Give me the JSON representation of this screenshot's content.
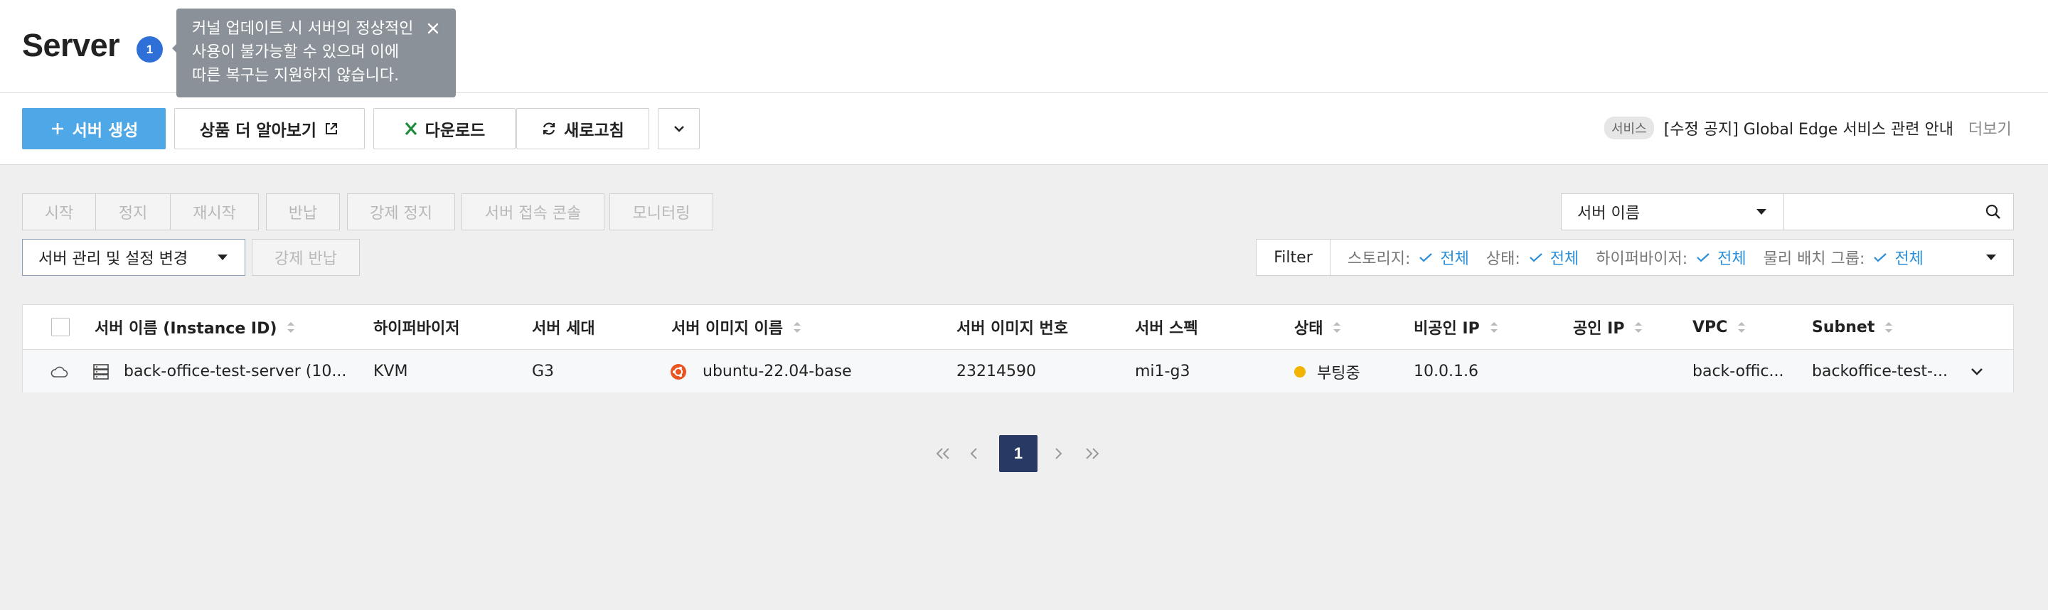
{
  "page": {
    "title": "Server",
    "badge_count": "1"
  },
  "tooltip": {
    "line1": "커널 업데이트 시 서버의 정상적인",
    "line2": "사용이 불가능할 수 있으며 이에",
    "line3": "따른 복구는 지원하지 않습니다."
  },
  "toolbar": {
    "create": "서버 생성",
    "learn_more": "상품 더 알아보기",
    "download": "다운로드",
    "refresh": "새로고침"
  },
  "notice": {
    "tag": "서비스",
    "text": "[수정 공지] Global Edge 서비스 관련 안내",
    "more": "더보기"
  },
  "actions": [
    "시작",
    "정지",
    "재시작",
    "반납",
    "강제 정지",
    "서버 접속 콘솔",
    "모니터링"
  ],
  "manage": {
    "label": "서버 관리 및 설정 변경",
    "force_return": "강제 반납"
  },
  "search": {
    "field": "서버 이름",
    "value": ""
  },
  "filter": {
    "label": "Filter",
    "items": [
      {
        "name": "스토리지:",
        "value": "전체"
      },
      {
        "name": "상태:",
        "value": "전체"
      },
      {
        "name": "하이퍼바이저:",
        "value": "전체"
      },
      {
        "name": "물리 배치 그룹:",
        "value": "전체"
      }
    ]
  },
  "table": {
    "columns": [
      "서버 이름 (Instance ID)",
      "하이퍼바이저",
      "서버 세대",
      "서버 이미지 이름",
      "서버 이미지 번호",
      "서버 스펙",
      "상태",
      "비공인 IP",
      "공인 IP",
      "VPC",
      "Subnet"
    ],
    "rows": [
      {
        "name": "back-office-test-server (10...",
        "hypervisor": "KVM",
        "generation": "G3",
        "image_name": "ubuntu-22.04-base",
        "image_no": "23214590",
        "spec": "mi1-g3",
        "status": "부팅중",
        "private_ip": "10.0.1.6",
        "public_ip": "",
        "vpc": "back-offic...",
        "subnet": "backoffice-test-..."
      }
    ]
  },
  "pagination": {
    "current": "1"
  },
  "colors": {
    "primary": "#4ea8e8",
    "status_booting": "#f0b400",
    "page_active": "#283a63",
    "filter_value": "#2a8fd8"
  }
}
